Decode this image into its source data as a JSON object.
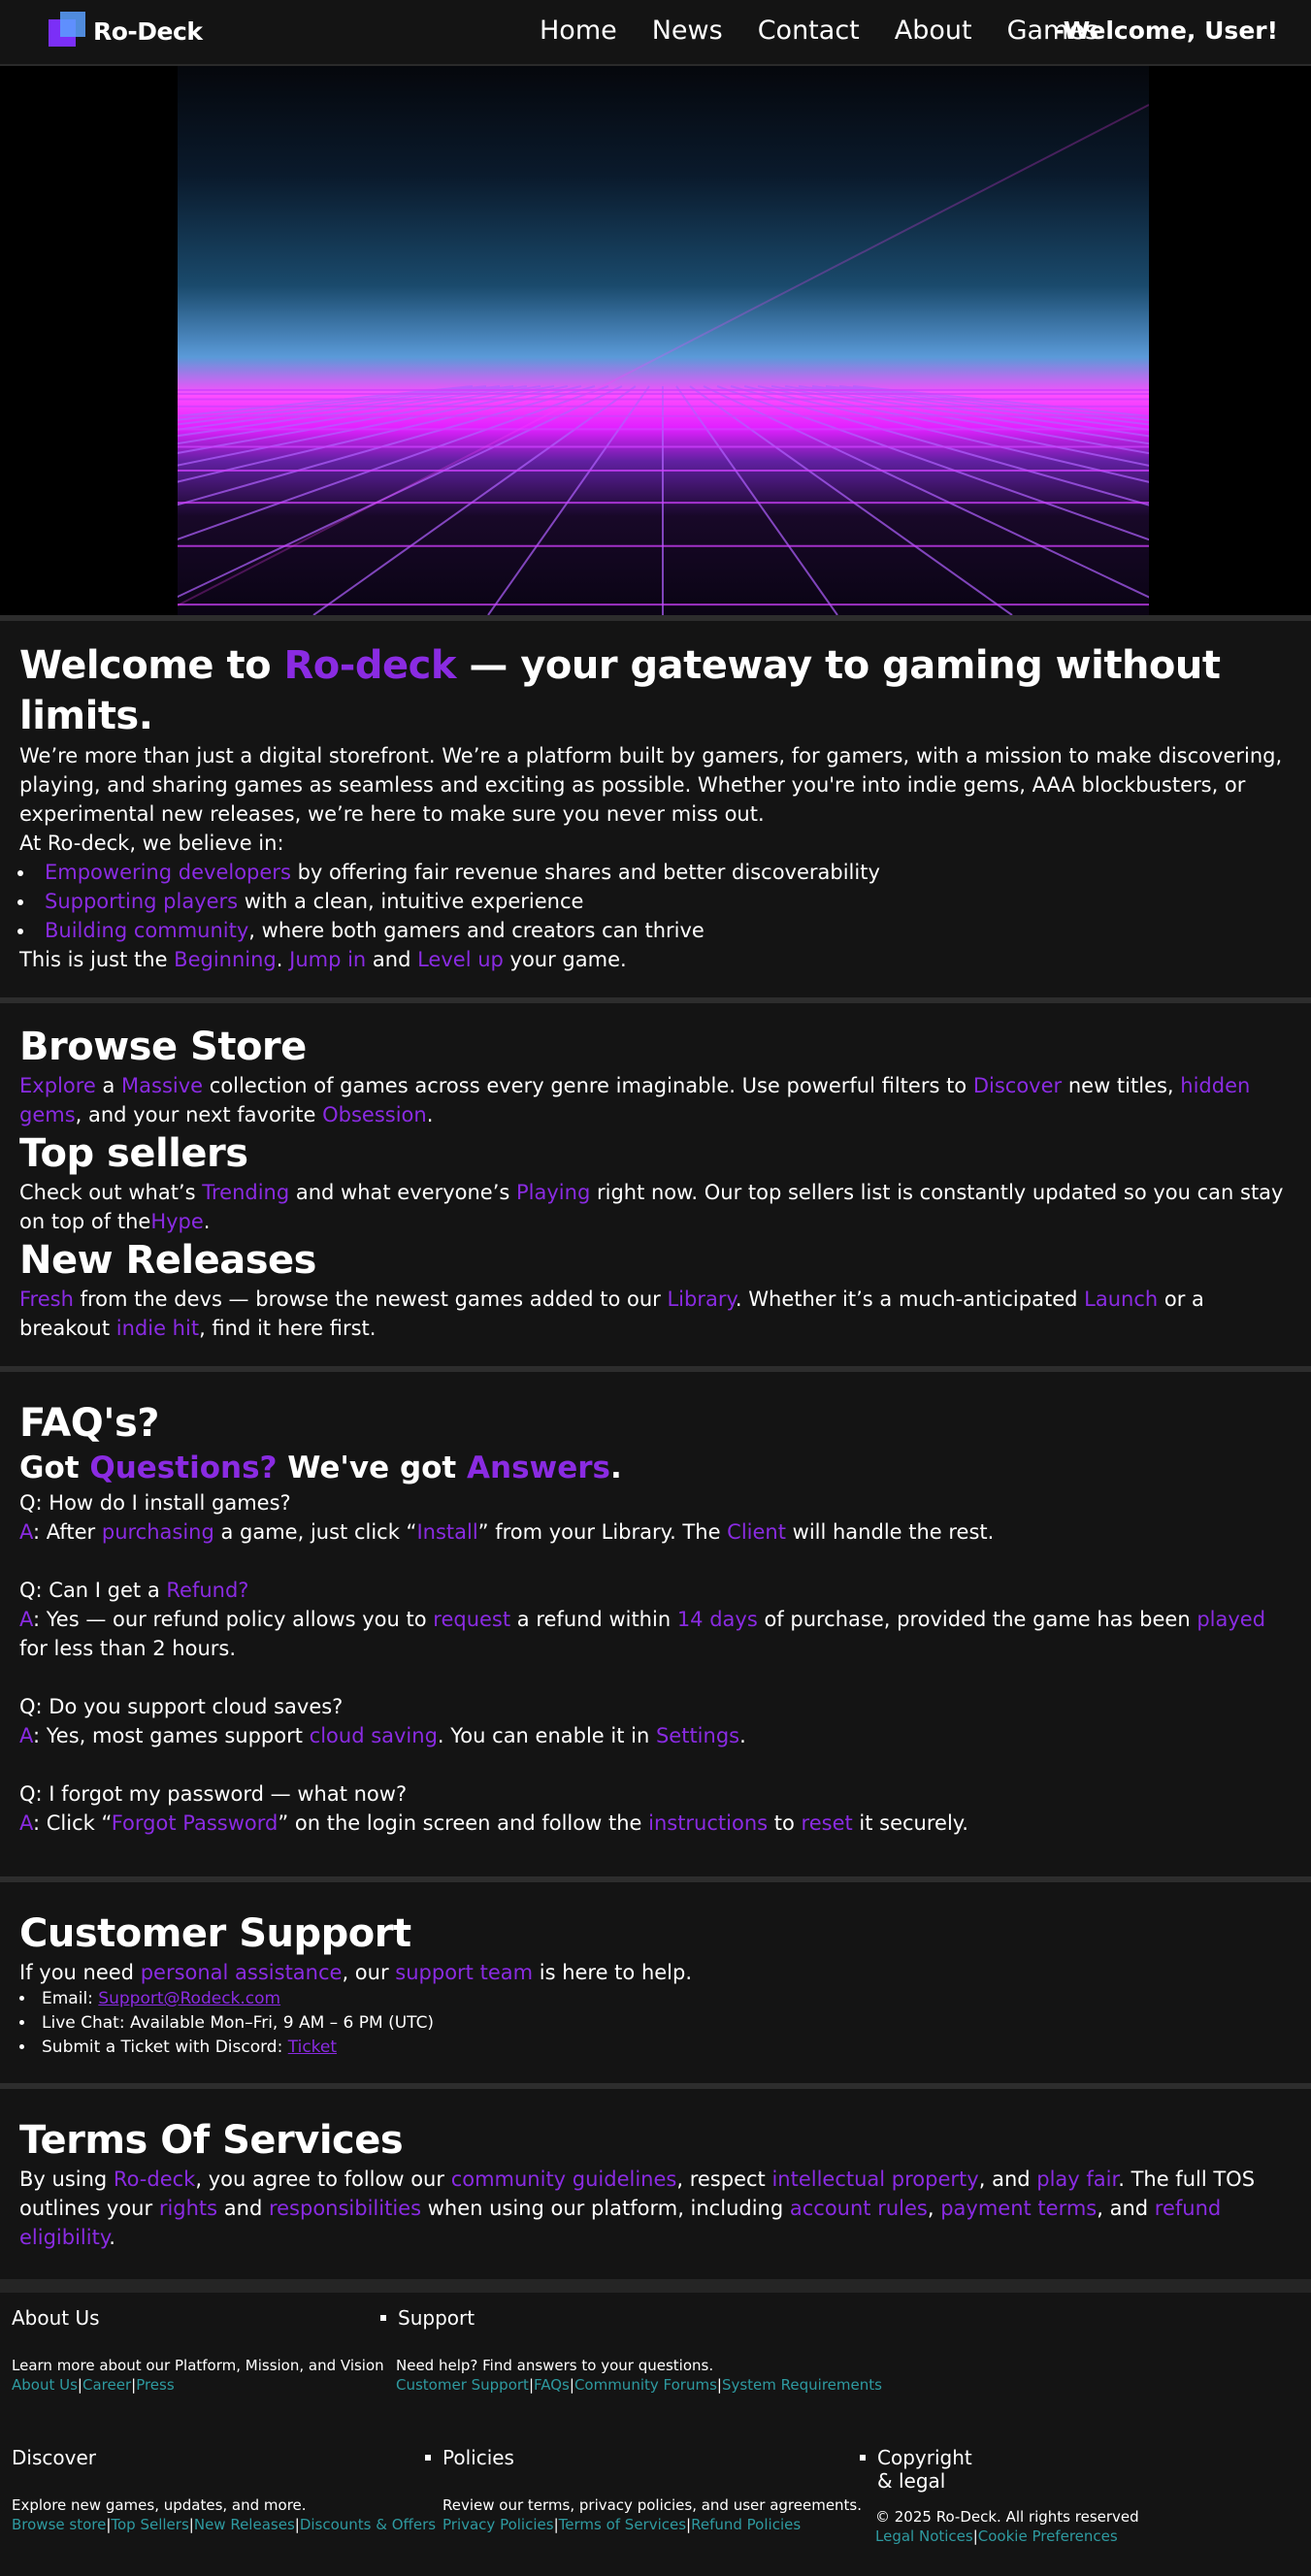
{
  "nav": {
    "logo_text": "Ro-Deck",
    "links": [
      "Home",
      "News",
      "Contact",
      "About",
      "Games"
    ],
    "welcome": "-Welcome, User!"
  },
  "intro": {
    "title_pre": "Welcome to ",
    "title_brand": "Ro-deck",
    "title_post": " — your gateway to gaming without limits.",
    "paragraph": "We’re more than just a digital storefront. We’re a platform built by gamers, for gamers, with a mission to make discovering, playing, and sharing games as seamless and exciting as possible. Whether you're into indie gems, AAA blockbusters, or experimental new releases, we’re here to make sure you never miss out.",
    "believe": "At Ro-deck, we believe in:",
    "bullets": [
      {
        "hl": "Empowering developers",
        "text": " by offering fair revenue shares and better discoverability"
      },
      {
        "hl": "Supporting players",
        "text": " with a clean, intuitive experience"
      },
      {
        "hl": "Building community",
        "text": ", where both gamers and creators can thrive"
      }
    ],
    "closing": {
      "a": "This is just the ",
      "b": "Beginning",
      "c": ". ",
      "d": "Jump in",
      "e": " and ",
      "f": "Level up",
      "g": " your game."
    }
  },
  "browse": {
    "title": "Browse Store",
    "p": {
      "a": "Explore",
      "b": " a ",
      "c": "Massive",
      "d": " collection of games across every genre imaginable. Use powerful filters to ",
      "e": "Discover",
      "f": " new titles, ",
      "g": "hidden gems",
      "h": ", and your next favorite ",
      "i": "Obsession",
      "j": "."
    },
    "top_title": "Top sellers",
    "top_p": {
      "a": "Check out what’s ",
      "b": "Trending",
      "c": " and what everyone’s ",
      "d": "Playing",
      "e": " right now. Our top sellers list is constantly updated so you can stay on top of the",
      "f": "Hype",
      "g": "."
    },
    "new_title": "New Releases",
    "new_p": {
      "a": "Fresh",
      "b": " from the devs — browse the newest games added to our ",
      "c": "Library",
      "d": ". Whether it’s a much-anticipated ",
      "e": "Launch",
      "f": " or a breakout ",
      "g": "indie hit",
      "h": ", find it here first."
    }
  },
  "faq": {
    "title": "FAQ's?",
    "sub": {
      "a": "Got ",
      "b": "Questions?",
      "c": " We've got ",
      "d": "Answers",
      "e": "."
    },
    "q1": "Q: How do I install games?",
    "a1": {
      "a": "A",
      "b": ": After ",
      "c": "purchasing",
      "d": " a game, just click “",
      "e": "Install",
      "f": "” from your Library. The ",
      "g": "Client",
      "h": " will handle the rest."
    },
    "q2": {
      "a": "Q: Can I get a ",
      "b": "Refund?"
    },
    "a2": {
      "a": "A",
      "b": ": Yes — our refund policy allows you to ",
      "c": "request",
      "d": " a refund within ",
      "e": "14 days",
      "f": " of purchase, provided the game has been ",
      "g": "played",
      "h": " for less than 2 hours."
    },
    "q3": "Q: Do you support cloud saves?",
    "a3": {
      "a": "A",
      "b": ": Yes, most games support ",
      "c": "cloud saving",
      "d": ". You can enable it in ",
      "e": "Settings",
      "f": "."
    },
    "q4": "Q: I forgot my password — what now?",
    "a4": {
      "a": "A",
      "b": ": Click “",
      "c": "Forgot Password",
      "d": "” on the login screen and follow the ",
      "e": "instructions",
      "f": " to ",
      "g": "reset",
      "h": " it securely."
    }
  },
  "support": {
    "title": "Customer Support",
    "p": {
      "a": "If you need ",
      "b": "personal assistance",
      "c": ", our ",
      "d": "support team",
      "e": " is here to help."
    },
    "email_label": "Email: ",
    "email": "Support@Rodeck.com",
    "live_chat": "Live Chat: Available Mon–Fri, 9 AM – 6 PM (UTC)",
    "discord_label": "Submit a Ticket with Discord: ",
    "discord_link": "Ticket"
  },
  "tos": {
    "title": "Terms Of Services",
    "p": {
      "a": "By using ",
      "b": "Ro-deck",
      "c": ", you agree to follow our ",
      "d": "community guidelines",
      "e": ", respect ",
      "f": "intellectual property",
      "g": ", and ",
      "h": "play fair",
      "i": ". The full TOS outlines your ",
      "j": "rights",
      "k": " and ",
      "l": "responsibilities",
      "m": " when using our platform, including ",
      "n": "account rules",
      "o": ", ",
      "p": "payment terms",
      "q": ", and ",
      "r": "refund eligibility",
      "s": "."
    }
  },
  "footer": {
    "about": {
      "title": "About Us",
      "desc": "Learn more about our Platform, Mission, and Vision",
      "links": [
        "About Us",
        "Career",
        "Press"
      ]
    },
    "support": {
      "title": "Support",
      "desc": "Need help? Find answers to your questions.",
      "links": [
        "Customer Support",
        "FAQs",
        "Community Forums",
        "System Requirements"
      ]
    },
    "discover": {
      "title": "Discover",
      "desc": "Explore new games, updates, and more.",
      "links": [
        "Browse store",
        "Top Sellers",
        "New Releases",
        "Discounts & Offers"
      ]
    },
    "policies": {
      "title": "Policies",
      "desc": "Review our terms, privacy policies, and user agreements.",
      "links": [
        "Privacy Policies",
        "Terms of Services",
        "Refund Policies"
      ]
    },
    "copyright": {
      "title1": "Copyright",
      "title2": "& legal",
      "desc": "© 2025 Ro-Deck. All rights reserved",
      "links": [
        "Legal Notices",
        "Cookie Preferences"
      ]
    }
  },
  "colors": {
    "accent": "#8a2be2",
    "link_teal": "#2e9aa0",
    "background": "#141414"
  }
}
